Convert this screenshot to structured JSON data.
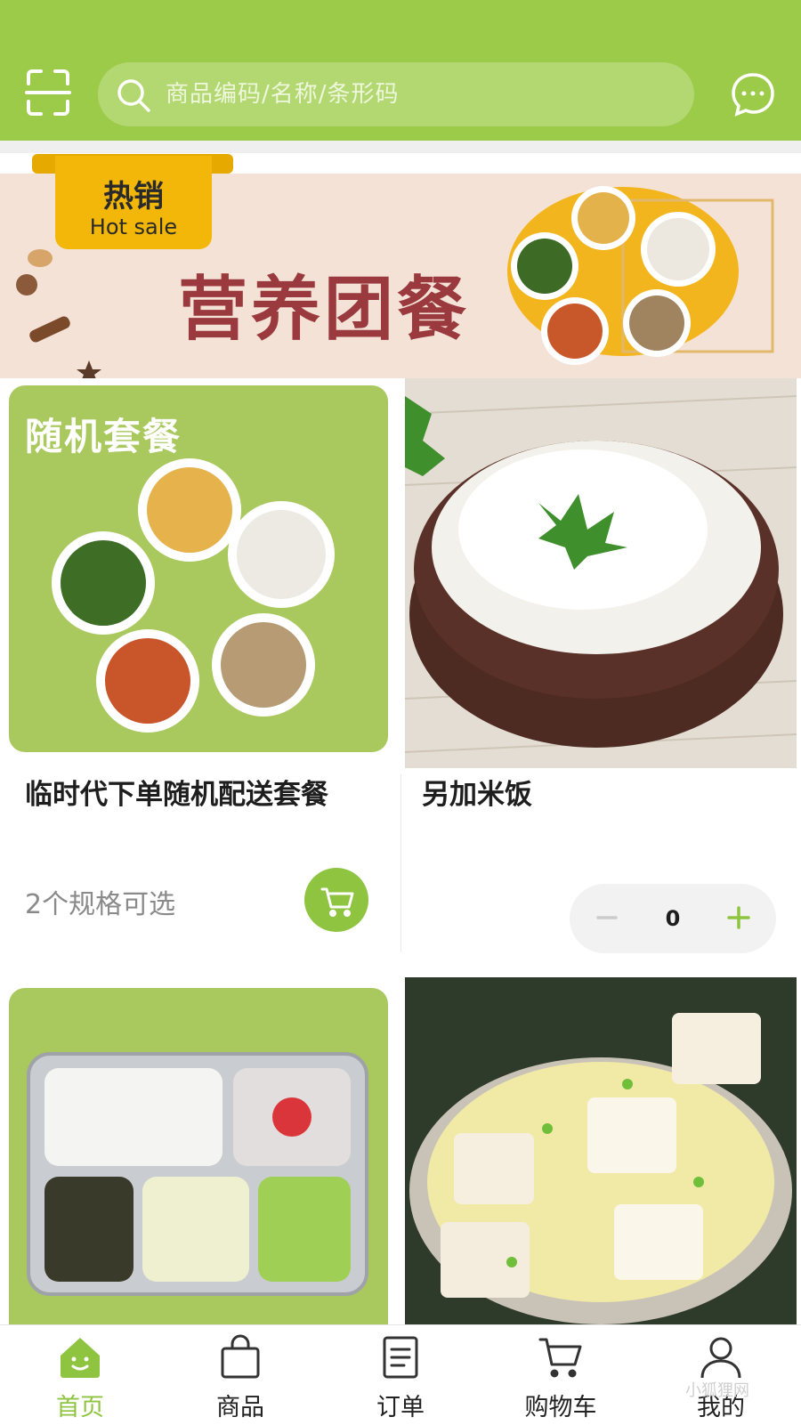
{
  "header": {
    "search_placeholder": "商品编码/名称/条形码",
    "accent_color": "#9ccb4a",
    "scan_icon": "scan-icon",
    "message_icon": "message-icon"
  },
  "banner": {
    "tag_cn": "热销",
    "tag_en": "Hot sale",
    "title": "营养团餐"
  },
  "products": [
    {
      "name": "临时代下单随机配送套餐",
      "image_text": "随机套餐",
      "sub": "2个规格可选",
      "action_icon": "cart-icon"
    },
    {
      "name": "另加米饭",
      "quantity": "0"
    }
  ],
  "tabbar": {
    "items": [
      {
        "label": "首页",
        "icon": "home-icon",
        "active": true
      },
      {
        "label": "商品",
        "icon": "bag-icon",
        "active": false
      },
      {
        "label": "订单",
        "icon": "order-icon",
        "active": false
      },
      {
        "label": "购物车",
        "icon": "cart-icon",
        "active": false
      },
      {
        "label": "我的",
        "icon": "user-icon",
        "active": false
      }
    ],
    "active_color": "#8fc441"
  },
  "watermark": "小狐狸网"
}
